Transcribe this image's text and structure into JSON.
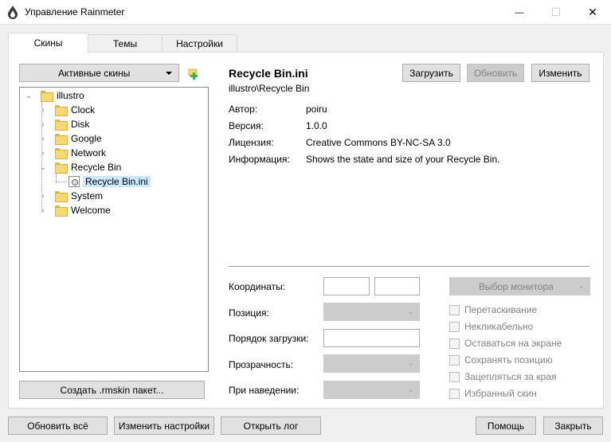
{
  "window": {
    "title": "Управление Rainmeter",
    "minimize_glyph": "—",
    "maximize_glyph": "☐",
    "close_glyph": "✕"
  },
  "tabs": [
    {
      "label": "Скины",
      "active": true
    },
    {
      "label": "Темы",
      "active": false
    },
    {
      "label": "Настройки",
      "active": false
    }
  ],
  "left": {
    "active_skins_label": "Активные скины",
    "create_package_label": "Создать .rmskin пакет..."
  },
  "tree": {
    "root": "illustro",
    "items": [
      "Clock",
      "Disk",
      "Google",
      "Network",
      "Recycle Bin",
      "System",
      "Welcome"
    ],
    "expanded_item": "Recycle Bin",
    "selected_file": "Recycle Bin.ini"
  },
  "skin": {
    "title": "Recycle Bin.ini",
    "path": "illustro\\Recycle Bin",
    "buttons": {
      "load": "Загрузить",
      "refresh": "Обновить",
      "edit": "Изменить"
    },
    "author_label": "Автор:",
    "author": "poiru",
    "version_label": "Версия:",
    "version": "1.0.0",
    "license_label": "Лицензия:",
    "license": "Creative Commons BY-NC-SA 3.0",
    "info_label": "Информация:",
    "info": "Shows the state and size of your Recycle Bin."
  },
  "settings": {
    "coords_label": "Координаты:",
    "position_label": "Позиция:",
    "load_order_label": "Порядок загрузки:",
    "transparency_label": "Прозрачность:",
    "on_hover_label": "При наведении:",
    "monitor_label": "Выбор монитора",
    "checkboxes": [
      "Перетаскивание",
      "Некликабельно",
      "Оставаться на экране",
      "Сохранять позицию",
      "Зацепляться за края",
      "Избранный скин"
    ]
  },
  "bottom": {
    "refresh_all": "Обновить всё",
    "edit_settings": "Изменить настройки",
    "open_log": "Открыть лог",
    "help": "Помощь",
    "close": "Закрыть"
  },
  "colors": {
    "selection": "#cce8ff",
    "folder": "#f8d775",
    "add_icon": "#3cb043"
  }
}
